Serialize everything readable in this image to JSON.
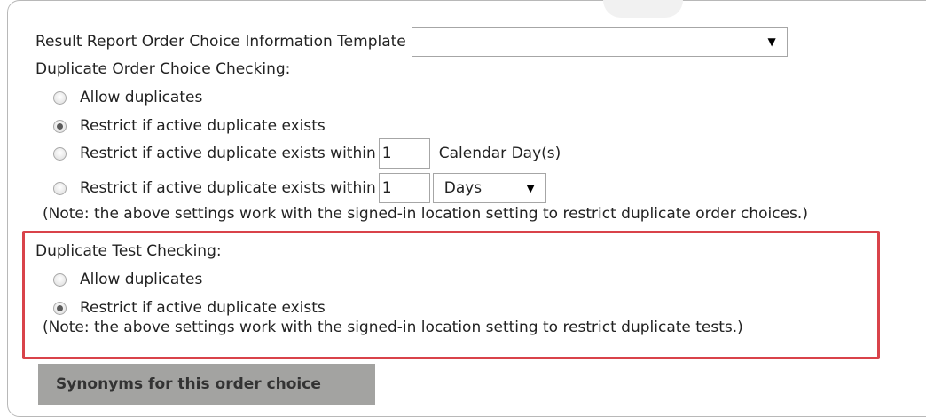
{
  "template_select": {
    "label": "Result Report Order Choice Information Template",
    "value": "",
    "arrow": "▼"
  },
  "order_checking": {
    "heading": "Duplicate Order Choice Checking:",
    "options": [
      {
        "label": "Allow duplicates",
        "checked": false
      },
      {
        "label": "Restrict if active duplicate exists",
        "checked": true
      },
      {
        "label": "Restrict if active duplicate exists within",
        "checked": false,
        "input_value": "1",
        "suffix": "Calendar Day(s)"
      },
      {
        "label": "Restrict if active duplicate exists within",
        "checked": false,
        "input_value": "1",
        "unit_select": "Days",
        "arrow": "▼"
      }
    ],
    "note": "(Note: the above settings work with the signed-in location setting to restrict duplicate order choices.)"
  },
  "test_checking": {
    "heading": "Duplicate Test Checking:",
    "options": [
      {
        "label": "Allow duplicates",
        "checked": false
      },
      {
        "label": "Restrict if active duplicate exists",
        "checked": true
      }
    ],
    "note": "(Note: the above settings work with the signed-in location setting to restrict duplicate tests.)"
  },
  "synonyms_button": {
    "label": "Synonyms for this order choice"
  },
  "colors": {
    "highlight_border": "#d9434a",
    "button_bg": "#a3a3a1"
  }
}
